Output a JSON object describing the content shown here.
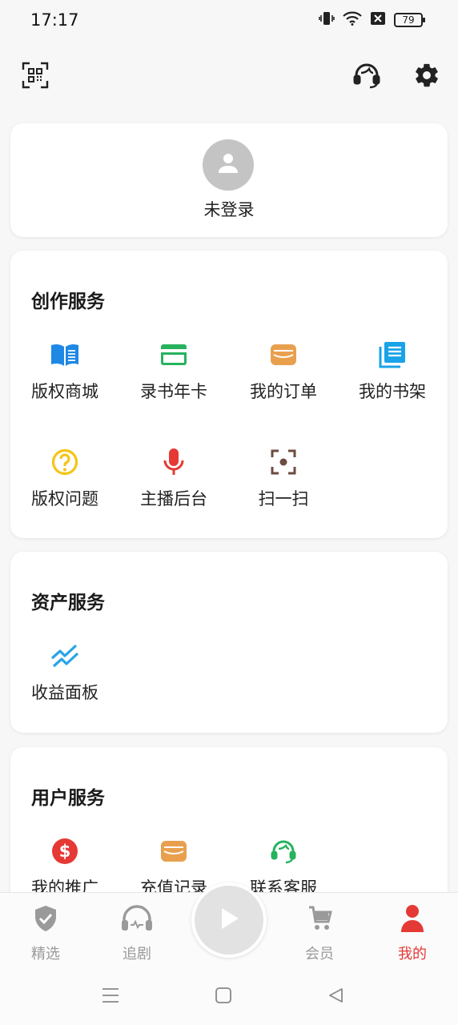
{
  "status_bar": {
    "time": "17:17",
    "battery": "79"
  },
  "header": {
    "scan_icon": "qr-scan-icon",
    "service_icon": "headset-icon",
    "settings_icon": "gear-icon"
  },
  "login": {
    "label": "未登录"
  },
  "creation": {
    "title": "创作服务",
    "items": [
      {
        "label": "版权商城",
        "icon": "book-icon",
        "color": "#1e88e5"
      },
      {
        "label": "录书年卡",
        "icon": "card-icon",
        "color": "#27b35e"
      },
      {
        "label": "我的订单",
        "icon": "wallet-icon",
        "color": "#e9a04e"
      },
      {
        "label": "我的书架",
        "icon": "bookshelf-icon",
        "color": "#1aa3e8"
      },
      {
        "label": "版权问题",
        "icon": "question-icon",
        "color": "#f5c518"
      },
      {
        "label": "主播后台",
        "icon": "mic-icon",
        "color": "#e53935"
      },
      {
        "label": "扫一扫",
        "icon": "scan-icon",
        "color": "#6d4c41"
      }
    ]
  },
  "assets": {
    "title": "资产服务",
    "items": [
      {
        "label": "收益面板",
        "icon": "trend-icon",
        "color": "#29a3e8"
      }
    ]
  },
  "user": {
    "title": "用户服务",
    "items": [
      {
        "label": "我的推广",
        "icon": "dollar-icon",
        "color": "#e53935"
      },
      {
        "label": "充值记录",
        "icon": "wallet-icon",
        "color": "#e9a04e"
      },
      {
        "label": "联系客服",
        "icon": "support-icon",
        "color": "#27b35e"
      }
    ]
  },
  "bottom_nav": {
    "items": [
      {
        "label": "精选",
        "icon": "shield-check-icon"
      },
      {
        "label": "追剧",
        "icon": "headphones-icon"
      },
      {
        "label": "会员",
        "icon": "cart-icon"
      },
      {
        "label": "我的",
        "icon": "user-icon",
        "active": true
      }
    ],
    "play_icon": "play-icon",
    "accent_color": "#e53935"
  }
}
